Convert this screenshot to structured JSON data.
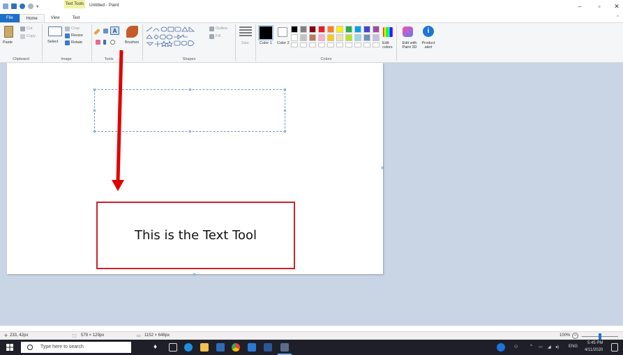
{
  "window": {
    "context_tab": "Text Tools",
    "title": "Untitled - Paint",
    "minimize": "–",
    "maximize": "▫",
    "close": "✕"
  },
  "tabs": [
    {
      "label": "File"
    },
    {
      "label": "Home"
    },
    {
      "label": "View"
    },
    {
      "label": "Text"
    }
  ],
  "ribbon_collapse": "^",
  "ribbon": {
    "clipboard": {
      "paste": "Paste",
      "cut": "Cut",
      "copy": "Copy",
      "label": "Clipboard"
    },
    "image": {
      "crop": "Crop",
      "resize": "Resize",
      "select": "Select",
      "rotate": "Rotate",
      "label": "Image"
    },
    "tools": {
      "brushes": "Brushes",
      "label": "Tools"
    },
    "shapes": {
      "outline": "Outline",
      "fill": "Fill",
      "label": "Shapes"
    },
    "size": {
      "label": "Size"
    },
    "colors": {
      "color1": "Color 1",
      "color2": "Color 2",
      "edit_colors": "Edit colors",
      "label": "Colors",
      "color1_value": "#000000",
      "color2_value": "#ffffff",
      "palette_row1": [
        "#000000",
        "#7f7f7f",
        "#880015",
        "#ed1c24",
        "#ff7f27",
        "#fff200",
        "#22b14c",
        "#00a2e8",
        "#3f48cc",
        "#a349a4"
      ],
      "palette_row2": [
        "#ffffff",
        "#c3c3c3",
        "#b97a57",
        "#ffaec9",
        "#ffc90e",
        "#efe4b0",
        "#b5e61d",
        "#99d9ea",
        "#7092be",
        "#c8bfe7"
      ]
    },
    "edit_paint3d": "Edit with Paint 3D",
    "product_alert": "Product alert"
  },
  "annotation": {
    "text": "This is the Text Tool",
    "color": "#e00000"
  },
  "statusbar": {
    "cursor": "233, 42px",
    "selection": "579 × 129px",
    "image_size": "1152 × 648px",
    "zoom": "100%"
  },
  "taskbar": {
    "search_placeholder": "Type here to search",
    "language": "ENG",
    "time": "5:45 PM",
    "date": "4/11/2020"
  }
}
